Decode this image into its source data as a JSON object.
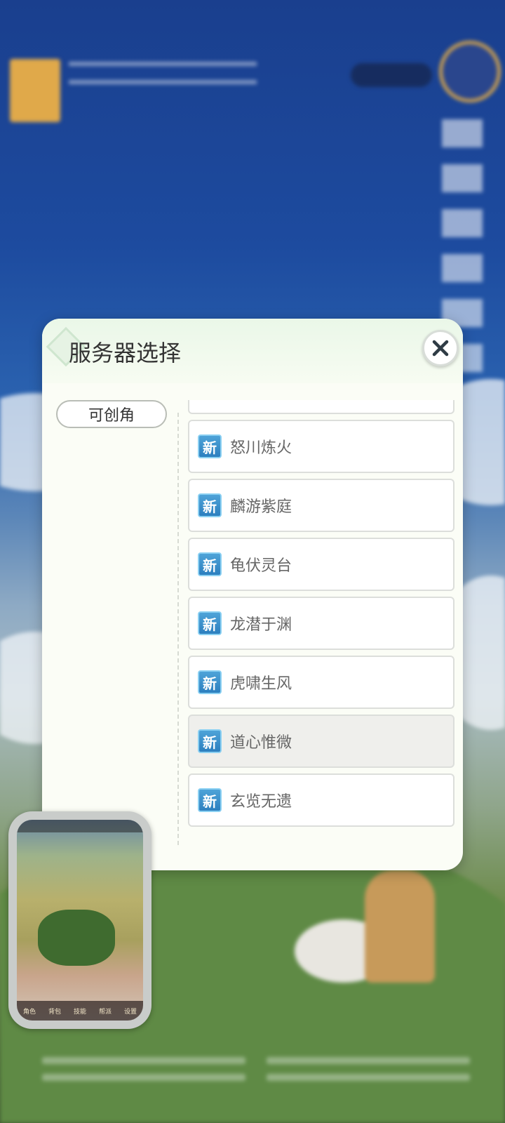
{
  "dialog": {
    "title": "服务器选择",
    "close_label": "✕"
  },
  "sidebar": {
    "categories": [
      {
        "label": "可创角"
      }
    ]
  },
  "servers": [
    {
      "badge": "新",
      "name": "怒川炼火"
    },
    {
      "badge": "新",
      "name": "麟游紫庭"
    },
    {
      "badge": "新",
      "name": "龟伏灵台"
    },
    {
      "badge": "新",
      "name": "龙潜于渊"
    },
    {
      "badge": "新",
      "name": "虎啸生风"
    },
    {
      "badge": "新",
      "name": "道心惟微",
      "selected": true
    },
    {
      "badge": "新",
      "name": "玄览无遗"
    }
  ],
  "mini_window": {
    "tabs": [
      "角色",
      "背包",
      "技能",
      "",
      "帮派",
      "设置"
    ]
  },
  "colors": {
    "badge_blue": "#2c7fbf",
    "dialog_bg": "#fbfdf6"
  }
}
